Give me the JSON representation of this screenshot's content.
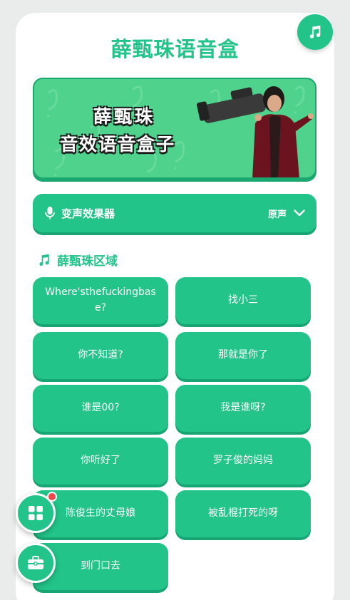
{
  "app": {
    "title": "薛甄珠语音盒"
  },
  "banner": {
    "line1": "薛甄珠",
    "line2": "音效语音盒子"
  },
  "voice_changer": {
    "title": "变声效果器",
    "value": "原声",
    "icon": "microphone-icon"
  },
  "section": {
    "title": "薛甄珠区域",
    "icon": "music-note-icon"
  },
  "sounds": [
    {
      "label": "Where'sthefuckingbase?"
    },
    {
      "label": "找小三"
    },
    {
      "label": "你不知道?"
    },
    {
      "label": "那就是你了"
    },
    {
      "label": "谁是00?"
    },
    {
      "label": "我是谁呀?"
    },
    {
      "label": "你听好了"
    },
    {
      "label": "罗子俊的妈妈"
    },
    {
      "label": "陈俊生的丈母娘"
    },
    {
      "label": "被乱棍打死的呀"
    },
    {
      "label": "到门口去"
    }
  ],
  "floating": {
    "apps_icon": "grid-icon",
    "toolbox_icon": "toolbox-icon",
    "music_icon": "music-note-icon"
  },
  "colors": {
    "accent": "#22c48a",
    "accent_dark": "#17a673",
    "badge": "#f04848"
  }
}
